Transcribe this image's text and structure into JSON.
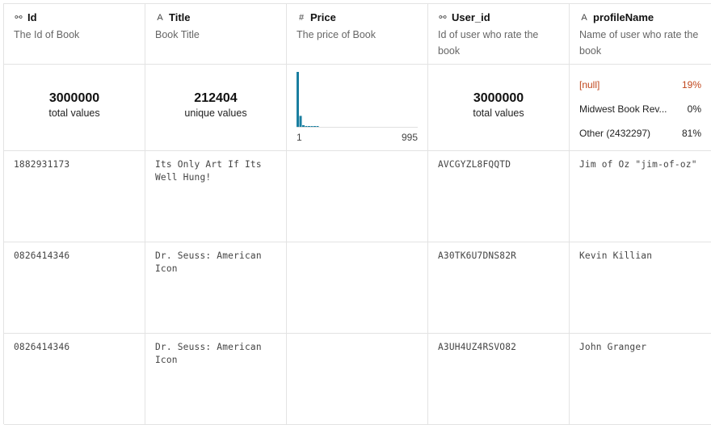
{
  "columns": [
    {
      "icon": "key-icon",
      "icon_glyph": "⚯",
      "name": "Id",
      "description": "The Id of Book"
    },
    {
      "icon": "text-icon",
      "icon_glyph": "A",
      "name": "Title",
      "description": "Book Title"
    },
    {
      "icon": "number-icon",
      "icon_glyph": "#",
      "name": "Price",
      "description": "The price of Book"
    },
    {
      "icon": "key-icon",
      "icon_glyph": "⚯",
      "name": "User_id",
      "description": "Id of user who rate the book"
    },
    {
      "icon": "text-icon",
      "icon_glyph": "A",
      "name": "profileName",
      "description": "Name of user who rate the book"
    }
  ],
  "stats": {
    "id": {
      "value": "3000000",
      "label": "total values"
    },
    "title": {
      "value": "212404",
      "label": "unique values"
    },
    "price": {
      "min": "1",
      "max": "995",
      "bar_color": "#1a7fa0",
      "histogram": [
        1.0,
        0.2,
        0.03,
        0.015,
        0.008,
        0.005,
        0.003,
        0.002
      ]
    },
    "user_id": {
      "value": "3000000",
      "label": "total values"
    },
    "profile": [
      {
        "label": "[null]",
        "percent": "19%",
        "is_null": true
      },
      {
        "label": "Midwest Book Rev...",
        "percent": "0%",
        "is_null": false
      },
      {
        "label": "Other (2432297)",
        "percent": "81%",
        "is_null": false
      }
    ]
  },
  "null_color": "#c0461c",
  "rows": [
    {
      "id": "1882931173",
      "title": "Its Only Art If Its Well Hung!",
      "price": "",
      "user_id": "AVCGYZL8FQQTD",
      "profile": "Jim of Oz \"jim-of-oz\""
    },
    {
      "id": "0826414346",
      "title": "Dr. Seuss: American Icon",
      "price": "",
      "user_id": "A30TK6U7DNS82R",
      "profile": "Kevin Killian"
    },
    {
      "id": "0826414346",
      "title": "Dr. Seuss: American Icon",
      "price": "",
      "user_id": "A3UH4UZ4RSVO82",
      "profile": "John Granger"
    }
  ]
}
